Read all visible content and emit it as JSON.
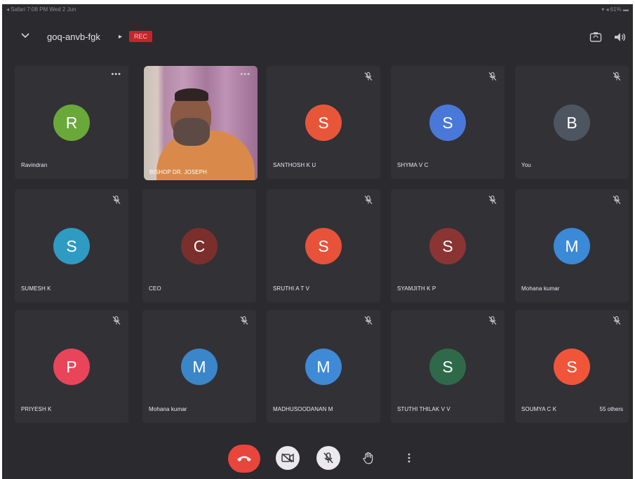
{
  "statusbar": {
    "left": "◂ Safari  7:08 PM  Wed 2 Jun",
    "right": "▾ ◂ 61% ▬"
  },
  "meeting": {
    "code": "goq-anvb-fgk",
    "rec_label": "REC"
  },
  "colors": {
    "background": "#2b2a2e",
    "tile": "#323136",
    "end_call": "#e8453c",
    "rec": "#c5242a"
  },
  "participants": [
    {
      "name": "Ravindran",
      "initial": "R",
      "color": "#6aa83a",
      "muted": false,
      "more": true
    },
    {
      "name": "BISHOP DR. JOSEPH",
      "video": true,
      "more": true
    },
    {
      "name": "SANTHOSH K U",
      "initial": "S",
      "color": "#e8563a",
      "muted": true
    },
    {
      "name": "SHYMA V C",
      "initial": "S",
      "color": "#4a78d8",
      "muted": true
    },
    {
      "name": "You",
      "initial": "B",
      "color": "#4d5560",
      "muted": true
    },
    {
      "name": "SUMESH K",
      "initial": "S",
      "color": "#2f9bc2",
      "muted": true
    },
    {
      "name": "CEO",
      "initial": "C",
      "color": "#7a2f2c",
      "muted": false
    },
    {
      "name": "SRUTHI A T V",
      "initial": "S",
      "color": "#e8523a",
      "muted": true
    },
    {
      "name": "SYAMJITH K P",
      "initial": "S",
      "color": "#8a3533",
      "muted": true
    },
    {
      "name": "Mohana kumar",
      "initial": "M",
      "color": "#3a8ad8",
      "muted": true
    },
    {
      "name": "PRIYESH K",
      "initial": "P",
      "color": "#e8455a",
      "muted": true
    },
    {
      "name": "Mohana kumar",
      "initial": "M",
      "color": "#3a86c8",
      "muted": true
    },
    {
      "name": "MADHUSOODANAN M",
      "initial": "M",
      "color": "#3f8ad6",
      "muted": true
    },
    {
      "name": "STUTHI THILAK V V",
      "initial": "S",
      "color": "#2e6a4a",
      "muted": true
    },
    {
      "name": "SOUMYA C K",
      "initial": "S",
      "color": "#f0553a",
      "muted": true,
      "others": "55 others"
    }
  ],
  "controls": {
    "end_call": "end-call",
    "camera": "camera-off",
    "mic": "mic-off",
    "hand": "raise-hand",
    "more": "more-options"
  }
}
